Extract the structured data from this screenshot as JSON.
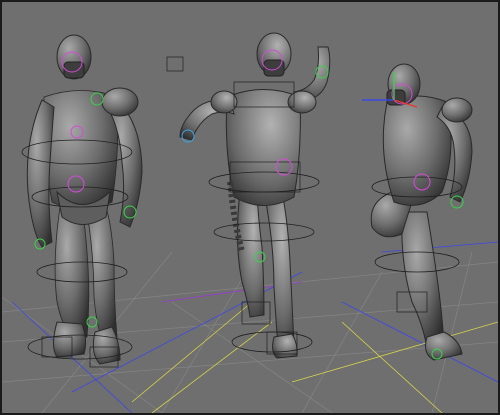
{
  "viewport": {
    "background": "#6f6f6f",
    "grid_color": "#8a8a8a",
    "model_color": "#6b6b6b",
    "wire_color": "#202020",
    "poses": [
      "front-idle-pose",
      "mid-waving-pose",
      "side-kick-pose"
    ]
  },
  "colors": {
    "control_green": "#39d24a",
    "control_magenta": "#d44bd9",
    "control_blue": "#3aa6e8",
    "control_yellow": "#d6d34a",
    "axis_red": "#e53a2c",
    "axis_blue": "#3a48e6"
  }
}
